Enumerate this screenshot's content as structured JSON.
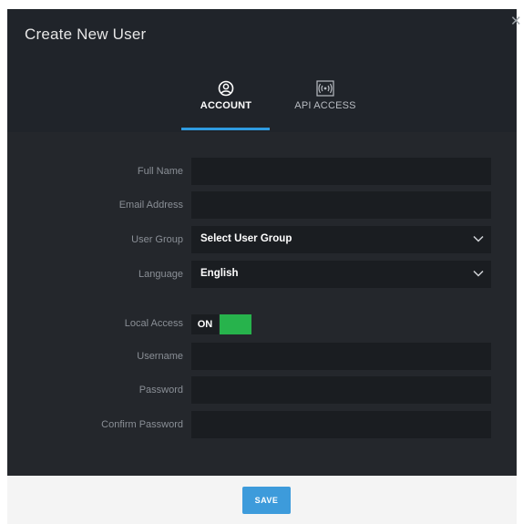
{
  "dialog": {
    "title": "Create New User",
    "close_icon": "close-icon"
  },
  "tabs": [
    {
      "label": "ACCOUNT",
      "icon": "user-circle-icon",
      "active": true
    },
    {
      "label": "API ACCESS",
      "icon": "broadcast-icon",
      "active": false
    }
  ],
  "form": {
    "full_name": {
      "label": "Full Name",
      "value": ""
    },
    "email": {
      "label": "Email Address",
      "value": ""
    },
    "user_group": {
      "label": "User Group",
      "value": "Select User Group"
    },
    "language": {
      "label": "Language",
      "value": "English"
    },
    "local_access": {
      "label": "Local Access",
      "state": "ON"
    },
    "username": {
      "label": "Username",
      "value": ""
    },
    "password": {
      "label": "Password",
      "value": ""
    },
    "confirm_password": {
      "label": "Confirm Password",
      "value": ""
    }
  },
  "footer": {
    "save_label": "SAVE"
  },
  "colors": {
    "accent": "#2f9be0",
    "toggle_on": "#27b34c",
    "save_button": "#3d9bdb"
  }
}
